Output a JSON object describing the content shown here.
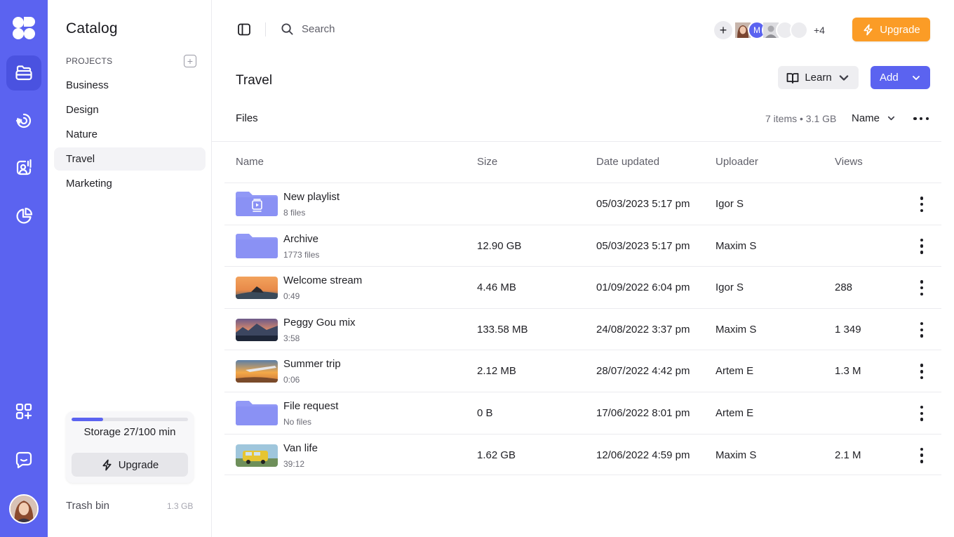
{
  "rail": {
    "items": [
      {
        "name": "rail-library",
        "icon": "folder-stack-icon",
        "active": true
      },
      {
        "name": "rail-live",
        "icon": "broadcast-icon",
        "active": false
      },
      {
        "name": "rail-studio",
        "icon": "person-audio-icon",
        "active": false
      },
      {
        "name": "rail-analytics",
        "icon": "pie-chart-icon",
        "active": false
      },
      {
        "name": "rail-apps",
        "icon": "apps-add-icon",
        "active": false
      },
      {
        "name": "rail-chat",
        "icon": "chat-icon",
        "active": false
      }
    ],
    "accent": "#5b63f0"
  },
  "sidebar": {
    "title": "Catalog",
    "projects_heading": "PROJECTS",
    "projects": [
      {
        "label": "Business",
        "active": false
      },
      {
        "label": "Design",
        "active": false
      },
      {
        "label": "Nature",
        "active": false
      },
      {
        "label": "Travel",
        "active": true
      },
      {
        "label": "Marketing",
        "active": false
      }
    ],
    "storage": {
      "label": "Storage 27/100 min",
      "used_fraction": 0.27,
      "upgrade_label": "Upgrade"
    },
    "trash": {
      "label": "Trash bin",
      "size": "1.3 GB"
    }
  },
  "topbar": {
    "search_placeholder": "Search",
    "team_avatar_letter": "M",
    "team_more": "+4",
    "upgrade_label": "Upgrade",
    "upgrade_color": "#fb9c26"
  },
  "page": {
    "title": "Travel",
    "learn_label": "Learn",
    "add_label": "Add",
    "files_label": "Files",
    "files_meta": "7 items • 3.1 GB",
    "sort_label": "Name"
  },
  "table": {
    "columns": {
      "name": "Name",
      "size": "Size",
      "date": "Date updated",
      "uploader": "Uploader",
      "views": "Views"
    },
    "rows": [
      {
        "kind": "playlist",
        "name": "New playlist",
        "sub": "8 files",
        "size": "",
        "date": "05/03/2023 5:17 pm",
        "uploader": "Igor S",
        "views": ""
      },
      {
        "kind": "folder",
        "name": "Archive",
        "sub": "1773 files",
        "size": "12.90 GB",
        "date": "05/03/2023 5:17 pm",
        "uploader": "Maxim S",
        "views": ""
      },
      {
        "kind": "video",
        "thumb": "sunset-yoga",
        "name": "Welcome stream",
        "sub": "0:49",
        "size": "4.46 MB",
        "date": "01/09/2022 6:04 pm",
        "uploader": "Igor S",
        "views": "288"
      },
      {
        "kind": "video",
        "thumb": "mountain-lake",
        "name": "Peggy Gou mix",
        "sub": "3:58",
        "size": "133.58 MB",
        "date": "24/08/2022 3:37 pm",
        "uploader": "Maxim S",
        "views": "1 349"
      },
      {
        "kind": "video",
        "thumb": "airplane-sunset",
        "name": "Summer trip",
        "sub": "0:06",
        "size": "2.12 MB",
        "date": "28/07/2022 4:42 pm",
        "uploader": "Artem E",
        "views": "1.3 M"
      },
      {
        "kind": "folder",
        "name": "File request",
        "sub": "No files",
        "size": "0 B",
        "date": "17/06/2022 8:01 pm",
        "uploader": "Artem E",
        "views": ""
      },
      {
        "kind": "video",
        "thumb": "yellow-van",
        "name": "Van life",
        "sub": "39:12",
        "size": "1.62 GB",
        "date": "12/06/2022 4:59 pm",
        "uploader": "Maxim S",
        "views": "2.1 M"
      }
    ]
  }
}
